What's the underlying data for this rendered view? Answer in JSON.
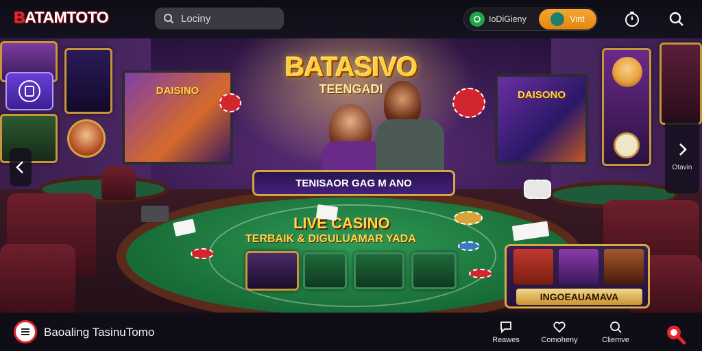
{
  "header": {
    "logo": "BATAMTOTO",
    "search_placeholder": "Lociny",
    "account_label": "IoDiGieny",
    "action_label": "Vint"
  },
  "hero": {
    "title": "BATASIVO",
    "subtitle": "TEENGADI",
    "tv_left_label": "DAISINO",
    "tv_right_label": "DAISONO",
    "banner_text": "TENISAOR GAG M ANO",
    "table_title": "LIVE CASINO",
    "table_subtitle": "TERBAIK & DIGULUAMAR YADA",
    "promo_label": "INGOEAUAMAVA",
    "side_caption": "Otavin"
  },
  "footer": {
    "brand_text": "Baoaling TasinuTomo",
    "nav": [
      {
        "label": "Reawes",
        "icon": "chat-icon"
      },
      {
        "label": "Comoheny",
        "icon": "heart-icon"
      },
      {
        "label": "Cliemve",
        "icon": "search-icon"
      }
    ]
  },
  "colors": {
    "accent_orange": "#f0961e",
    "brand_red": "#e8242b",
    "gold": "#d4a640"
  }
}
